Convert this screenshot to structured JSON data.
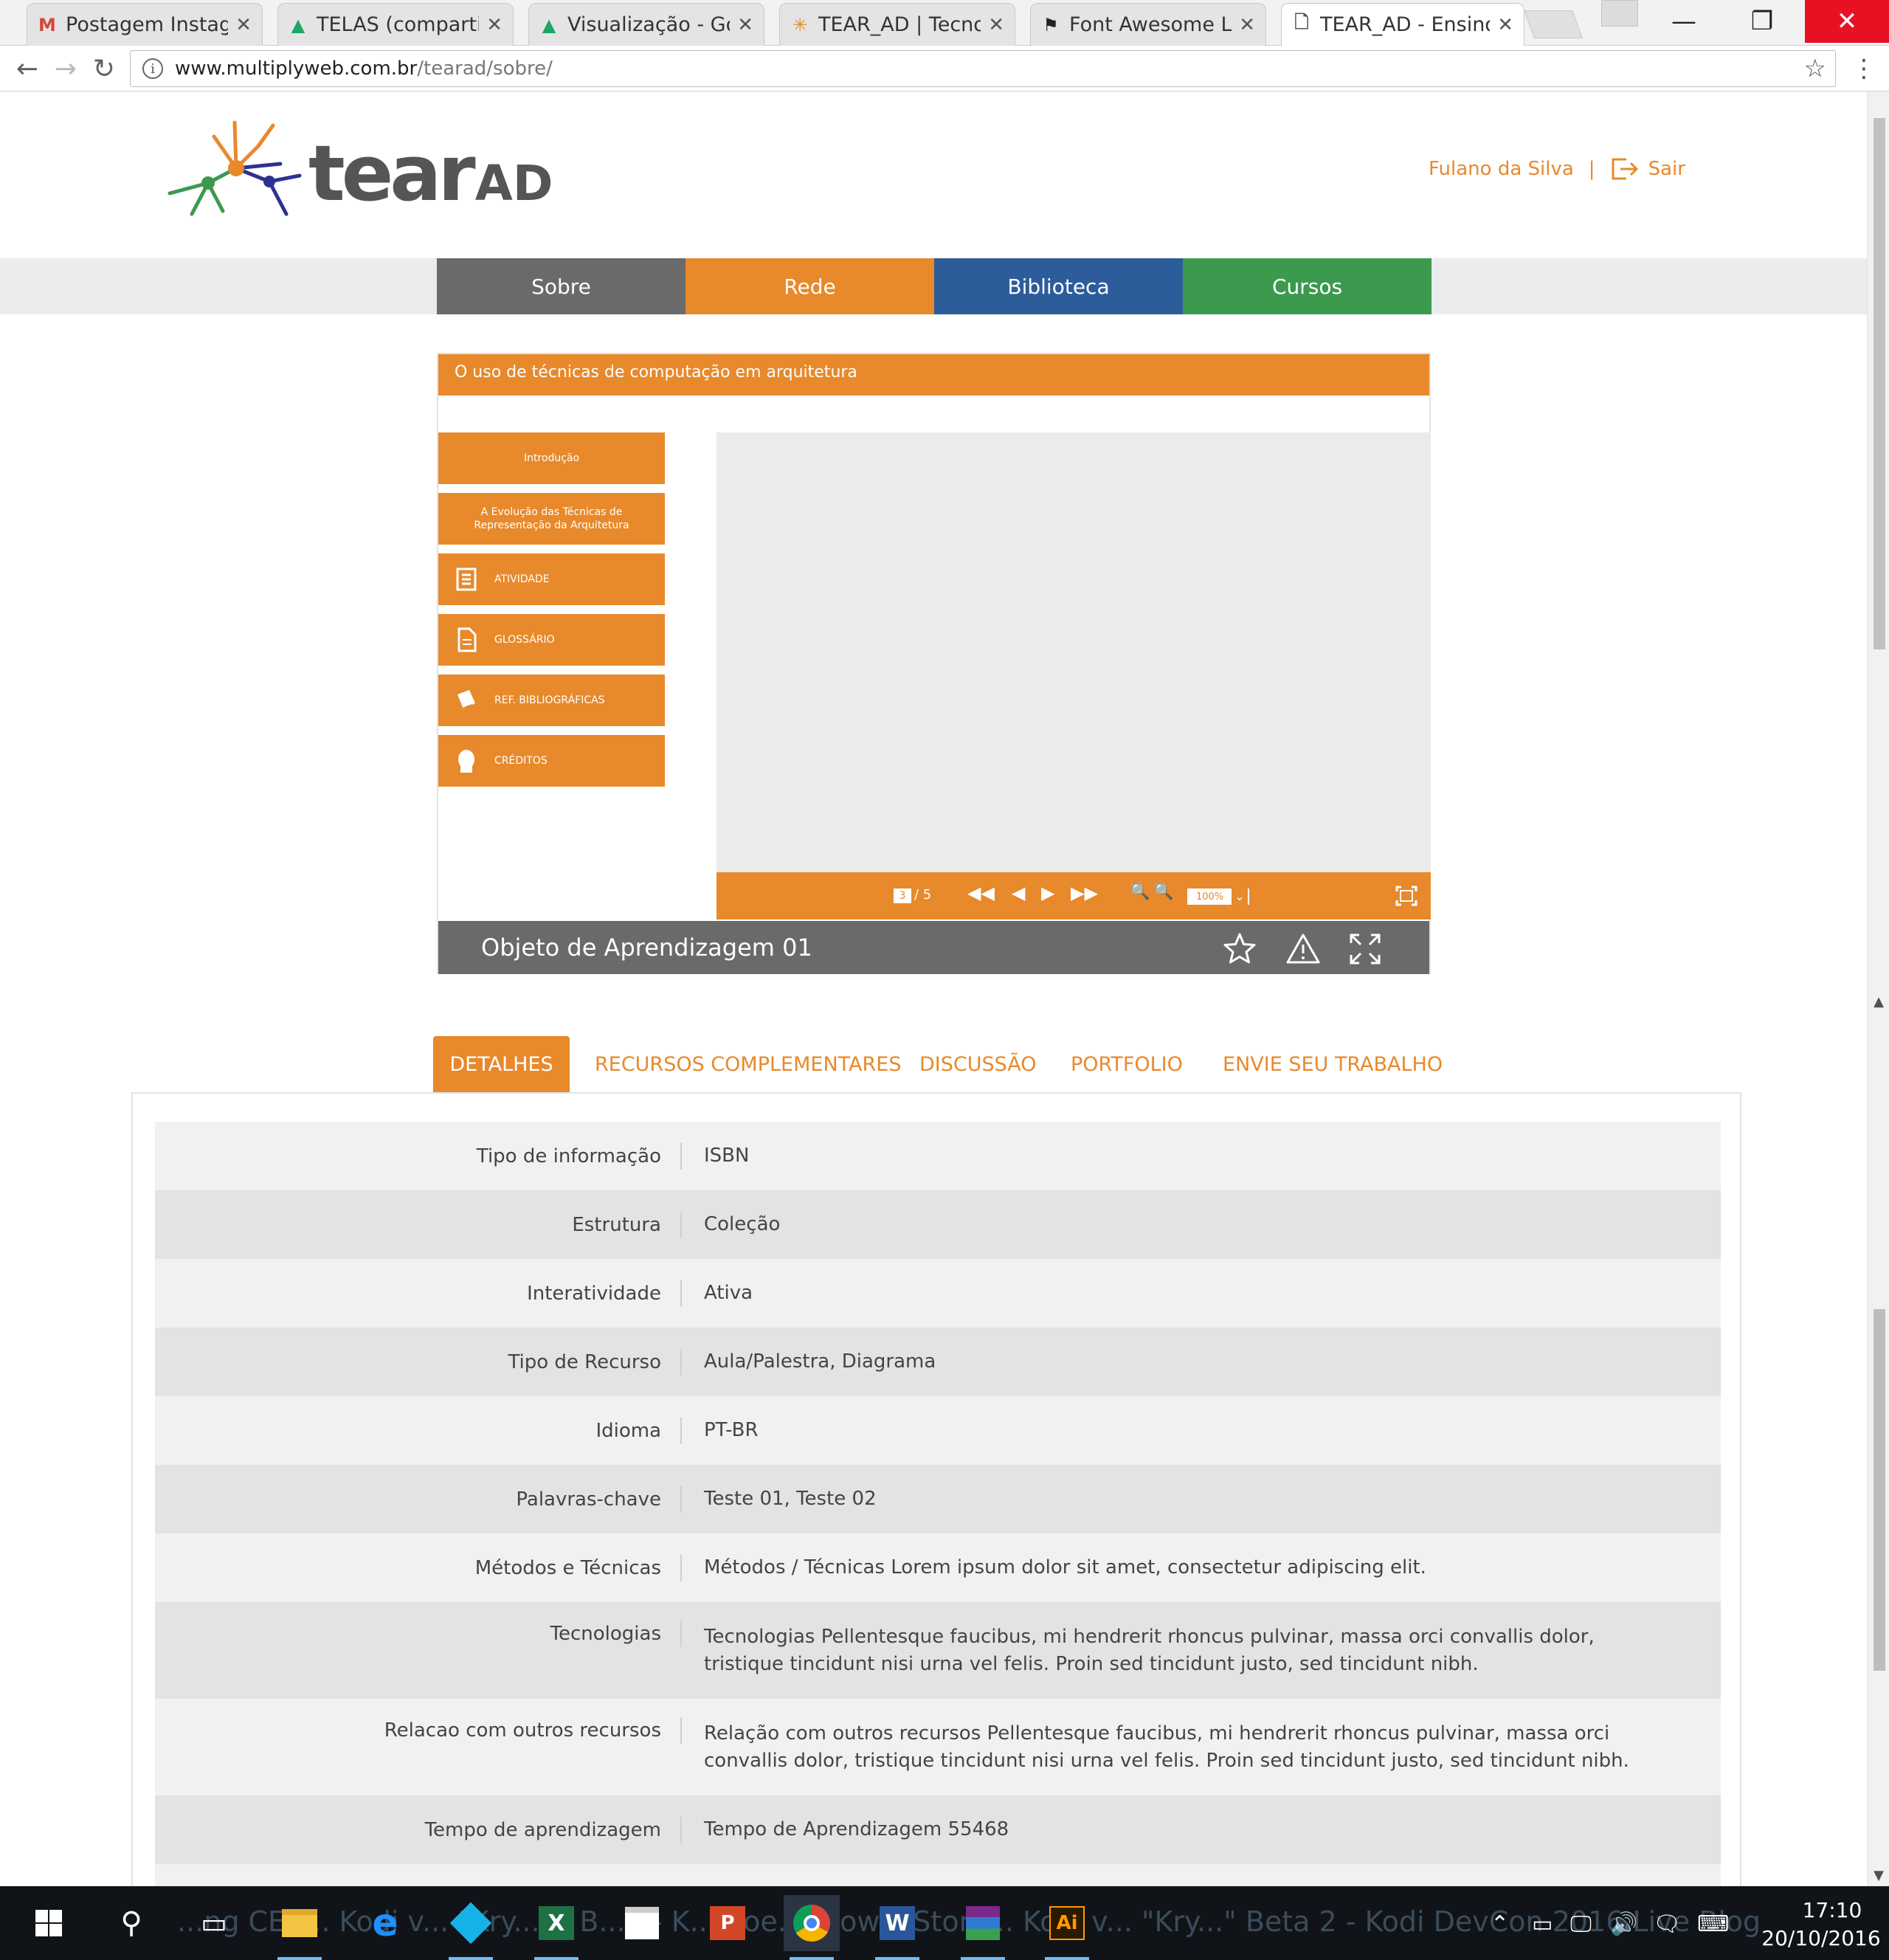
{
  "browser": {
    "tabs": [
      {
        "title": "Postagem Instagra",
        "icon": "gmail-icon",
        "color": "#d44638"
      },
      {
        "title": "TELAS (compartilh",
        "icon": "google-drive-icon",
        "color": "#1fa463"
      },
      {
        "title": "Visualização - Goo",
        "icon": "google-drive-icon",
        "color": "#1fa463"
      },
      {
        "title": "TEAR_AD | Tecnolo",
        "icon": "tearad-favicon",
        "color": "#e8892b"
      },
      {
        "title": "Font Awesome Lic",
        "icon": "font-awesome-icon",
        "color": "#222222"
      },
      {
        "title": "TEAR_AD - Ensino",
        "icon": "page-icon",
        "color": "#555555"
      }
    ],
    "url_host": "www.multiplyweb.com.br",
    "url_path": "/tearad/sobre/"
  },
  "site": {
    "logo_main": "tear",
    "logo_suffix": "AD",
    "user_name": "Fulano da Silva",
    "separator": "|",
    "logout_label": "Sair"
  },
  "nav": [
    {
      "label": "Sobre",
      "color": "#6a6a6a"
    },
    {
      "label": "Rede",
      "color": "#e8892b"
    },
    {
      "label": "Biblioteca",
      "color": "#2d5c9b"
    },
    {
      "label": "Cursos",
      "color": "#3c9a4e"
    }
  ],
  "player": {
    "title": "O uso de técnicas de computação em arquitetura",
    "menu": [
      {
        "label": "Introdução",
        "icon": ""
      },
      {
        "label": "A Evolução das Técnicas de Representação da Arquitetura",
        "icon": ""
      },
      {
        "label": "ATIVIDADE",
        "icon": "activity-icon"
      },
      {
        "label": "GLOSSÁRIO",
        "icon": "document-icon"
      },
      {
        "label": "REF. BIBLIOGRÁFICAS",
        "icon": "book-icon"
      },
      {
        "label": "CRÉDITOS",
        "icon": "person-icon"
      }
    ],
    "current_page": "3",
    "total_pages": "/ 5",
    "zoom": "100%",
    "object_title": "Objeto de Aprendizagem 01"
  },
  "content_tabs": [
    "DETALHES",
    "RECURSOS COMPLEMENTARES",
    "DISCUSSÃO",
    "PORTFOLIO",
    "ENVIE SEU TRABALHO"
  ],
  "details": [
    {
      "label": "Tipo de informação",
      "value": "ISBN"
    },
    {
      "label": "Estrutura",
      "value": "Coleção"
    },
    {
      "label": "Interatividade",
      "value": "Ativa"
    },
    {
      "label": "Tipo de Recurso",
      "value": "Aula/Palestra, Diagrama"
    },
    {
      "label": "Idioma",
      "value": "PT-BR"
    },
    {
      "label": "Palavras-chave",
      "value": "Teste 01, Teste 02"
    },
    {
      "label": "Métodos e Técnicas",
      "value": "Métodos / Técnicas Lorem ipsum dolor sit amet, consectetur adipiscing elit."
    },
    {
      "label": "Tecnologias",
      "value": "Tecnologias Pellentesque faucibus, mi hendrerit rhoncus pulvinar, massa orci convallis dolor, tristique tincidunt nisi urna vel felis. Proin sed tincidunt justo, sed tincidunt nibh."
    },
    {
      "label": "Relacao com outros recursos",
      "value": "Relação com outros recursos Pellentesque faucibus, mi hendrerit rhoncus pulvinar, massa orci convallis dolor, tristique tincidunt nisi urna vel felis. Proin sed tincidunt justo, sed tincidunt nibh."
    },
    {
      "label": "Tempo de aprendizagem",
      "value": "Tempo de Aprendizagem 55468"
    }
  ],
  "taskbar": {
    "ghost_text": "...ng CES... Kodi v... \"Kry...n\" B...3 - K... goe...ndow... Store... Kodi v... \"Kry...\" Beta 2 - Kodi DevCon 2016 Live Blog",
    "time": "17:10",
    "date": "20/10/2016"
  },
  "colors": {
    "accent": "#e8892b",
    "gray": "#6a6a6a",
    "blue": "#2d5c9b",
    "green": "#3c9a4e"
  }
}
